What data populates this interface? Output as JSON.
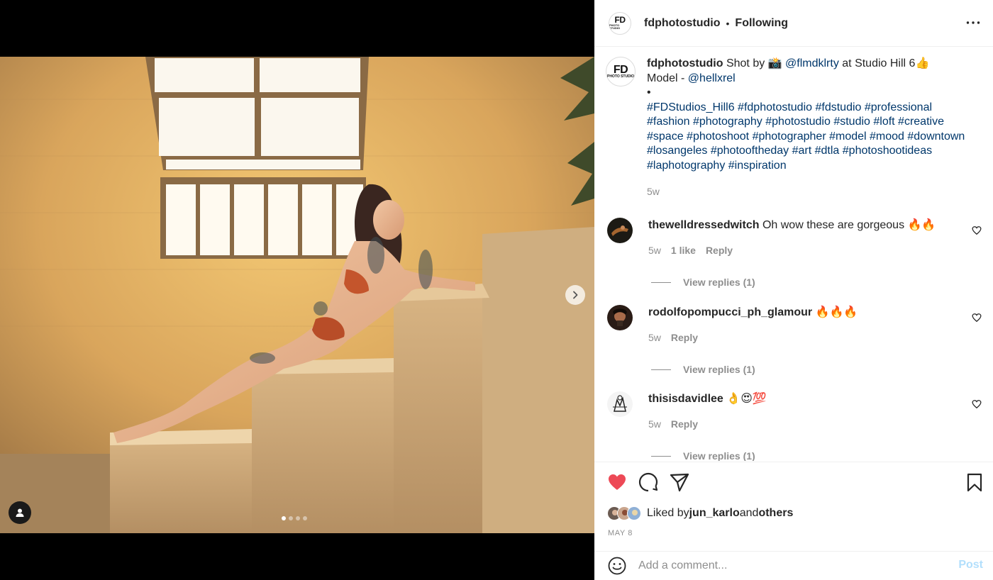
{
  "post": {
    "username": "fdphotostudio",
    "separator": "•",
    "follow_status": "Following",
    "avatar_text_big": "FD",
    "avatar_text_small": "PHOTO STUDIO"
  },
  "caption": {
    "username": "fdphotostudio",
    "text_1": " Shot by 📸 ",
    "mention_1": "@flmdklrty",
    "text_2": " at Studio Hill 6👍",
    "text_3": "Model - ",
    "mention_2": "@hellxrel",
    "bullet": "•",
    "hashtags": "#FDStudios_Hill6 #fdphotostudio #fdstudio #professional #fashion #photography #photostudio #studio #loft #creative #space #photoshoot #photographer #model #mood #downtown #losangeles #photooftheday #art #dtla #photoshootideas #laphotography #inspiration",
    "time": "5w"
  },
  "comments": [
    {
      "username": "thewelldressedwitch",
      "text": " Oh wow these are gorgeous 🔥🔥",
      "time": "5w",
      "likes": "1 like",
      "reply_label": "Reply",
      "view_replies": "View replies (1)"
    },
    {
      "username": "rodolfopompucci_ph_glamour",
      "text": " 🔥🔥🔥",
      "time": "5w",
      "reply_label": "Reply",
      "view_replies": "View replies (1)"
    },
    {
      "username": "thisisdavidlee",
      "text": " 👌😍💯",
      "time": "5w",
      "reply_label": "Reply",
      "view_replies": "View replies (1)"
    }
  ],
  "likes": {
    "prefix": "Liked by ",
    "user": "jun_karlo",
    "middle": " and ",
    "others": "others"
  },
  "date": "MAY 8",
  "add_comment": {
    "placeholder": "Add a comment...",
    "post_label": "Post"
  },
  "carousel": {
    "total_slides": 4,
    "active_slide": 1
  },
  "colors": {
    "like_red": "#ed4956",
    "link_blue": "#00376b",
    "post_blue_disabled": "#b2dffc",
    "muted_gray": "#8e8e8e"
  },
  "icons": [
    "more-icon",
    "heart-icon",
    "comment-icon",
    "share-icon",
    "bookmark-icon",
    "emoji-icon",
    "chevron-right-icon",
    "user-tag-icon"
  ]
}
